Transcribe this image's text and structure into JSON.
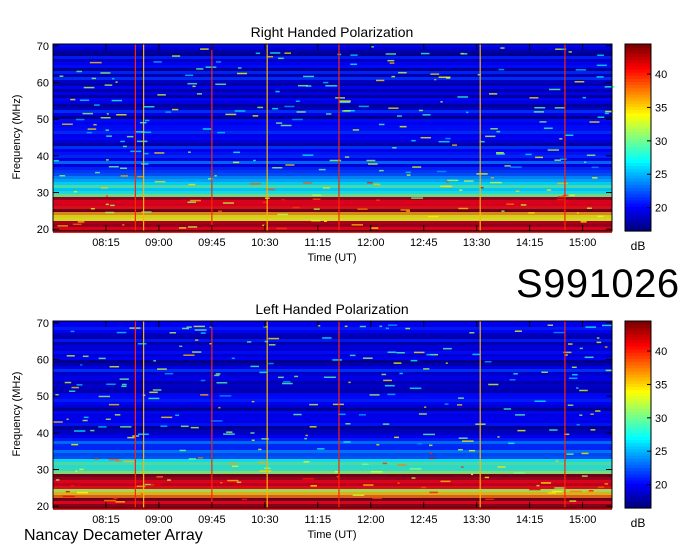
{
  "figure_id": "S991026",
  "footer": "Nancay Decameter Array",
  "colors": {
    "axis": "#000000",
    "background": "#ffffff",
    "colormap": [
      "#00007f",
      "#0000ff",
      "#0080ff",
      "#00ffff",
      "#80ff80",
      "#ffff00",
      "#ff8000",
      "#ff0000",
      "#7f0000"
    ]
  },
  "chart_data": [
    {
      "type": "heatmap",
      "title": "Right Handed Polarization",
      "xlabel": "Time (UT)",
      "ylabel": "Frequency (MHz)",
      "x_ticks": [
        "08:15",
        "09:00",
        "09:45",
        "10:30",
        "11:15",
        "12:00",
        "12:45",
        "13:30",
        "14:15",
        "15:00"
      ],
      "xlim": [
        "07:30",
        "15:25"
      ],
      "y_ticks": [
        20,
        30,
        40,
        50,
        60,
        70
      ],
      "ylim": [
        19.5,
        70.5
      ],
      "colorbar": {
        "label": "dB",
        "ticks": [
          20,
          25,
          30,
          35,
          40
        ],
        "range": [
          16.5,
          44.5
        ]
      },
      "bright_bands_mhz": [
        20.5,
        22,
        25.5,
        27,
        28.5
      ],
      "vertical_bursts_ut": [
        "08:40",
        "08:47",
        "09:45",
        "10:32",
        "11:33",
        "13:33",
        "14:45"
      ]
    },
    {
      "type": "heatmap",
      "title": "Left Handed Polarization",
      "xlabel": "Time (UT)",
      "ylabel": "Frequency (MHz)",
      "x_ticks": [
        "08:15",
        "09:00",
        "09:45",
        "10:30",
        "11:15",
        "12:00",
        "12:45",
        "13:30",
        "14:15",
        "15:00"
      ],
      "xlim": [
        "07:30",
        "15:25"
      ],
      "y_ticks": [
        20,
        30,
        40,
        50,
        60,
        70
      ],
      "ylim": [
        19.5,
        70.5
      ],
      "colorbar": {
        "label": "dB",
        "ticks": [
          20,
          25,
          30,
          35,
          40
        ],
        "range": [
          16.5,
          44.5
        ]
      },
      "bright_bands_mhz": [
        20.5,
        22,
        25.5,
        27,
        28.5
      ],
      "vertical_bursts_ut": [
        "08:40",
        "08:47",
        "09:45",
        "10:32",
        "11:33",
        "13:33",
        "14:45"
      ]
    }
  ]
}
